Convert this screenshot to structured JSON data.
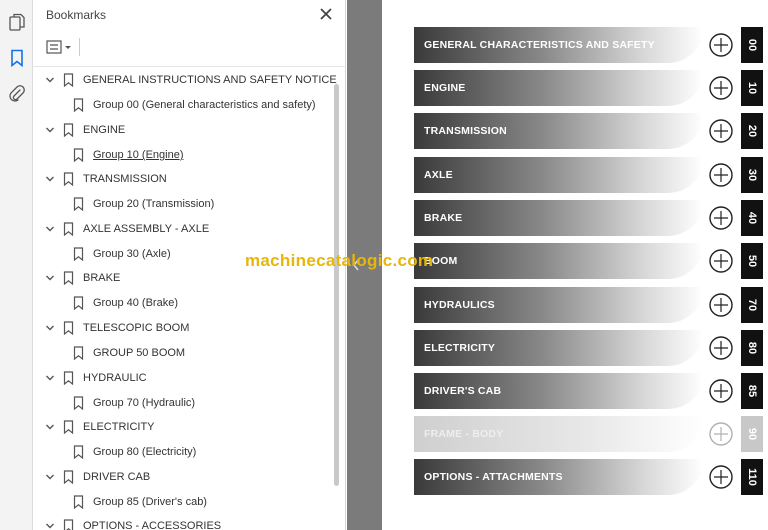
{
  "panel": {
    "title": "Bookmarks"
  },
  "icons": {
    "rail": [
      "pages-icon",
      "bookmark-icon",
      "attachment-icon"
    ],
    "close": "close-icon",
    "options": "bookmark-options-icon"
  },
  "bookmarks": [
    {
      "label": "GENERAL INSTRUCTIONS AND SAFETY NOTICE",
      "child": "Group 00 (General characteristics and safety)"
    },
    {
      "label": "ENGINE",
      "child": "Group 10 (Engine)"
    },
    {
      "label": "TRANSMISSION",
      "child": "Group 20 (Transmission)"
    },
    {
      "label": "AXLE ASSEMBLY - AXLE",
      "child": "Group 30 (Axle)"
    },
    {
      "label": "BRAKE",
      "child": "Group 40 (Brake)"
    },
    {
      "label": "TELESCOPIC BOOM",
      "child": "GROUP 50 BOOM"
    },
    {
      "label": "HYDRAULIC",
      "child": "Group 70 (Hydraulic)"
    },
    {
      "label": "ELECTRICITY",
      "child": "Group 80 (Electricity)"
    },
    {
      "label": "DRIVER CAB",
      "child": "Group 85 (Driver's cab)"
    },
    {
      "label": "OPTIONS - ACCESSORIES",
      "child": ""
    }
  ],
  "tabs": [
    {
      "label": "GENERAL CHARACTERISTICS AND SAFETY",
      "number": "00",
      "icon": "safety-equipment-icon"
    },
    {
      "label": "ENGINE",
      "number": "10",
      "icon": "engine-icon"
    },
    {
      "label": "TRANSMISSION",
      "number": "20",
      "icon": "transmission-icon"
    },
    {
      "label": "AXLE",
      "number": "30",
      "icon": "axle-icon"
    },
    {
      "label": "BRAKE",
      "number": "40",
      "icon": "brake-icon"
    },
    {
      "label": "BOOM",
      "number": "50",
      "icon": "boom-icon"
    },
    {
      "label": "HYDRAULICS",
      "number": "70",
      "icon": "hydraulics-icon"
    },
    {
      "label": "ELECTRICITY",
      "number": "80",
      "icon": "battery-icon"
    },
    {
      "label": "DRIVER'S CAB",
      "number": "85",
      "icon": "cab-icon"
    },
    {
      "label": "FRAME - BODY",
      "number": "90",
      "icon": "frame-icon"
    },
    {
      "label": "OPTIONS - ATTACHMENTS",
      "number": "110",
      "icon": "attachment-tool-icon"
    }
  ],
  "watermark": "machinecatalogic.com",
  "colors": {
    "tab_dark": "#3a3a3a",
    "tab_light": "#d9d9d9",
    "faded": "#cfcfcf",
    "watermark": "#e7b60a"
  }
}
